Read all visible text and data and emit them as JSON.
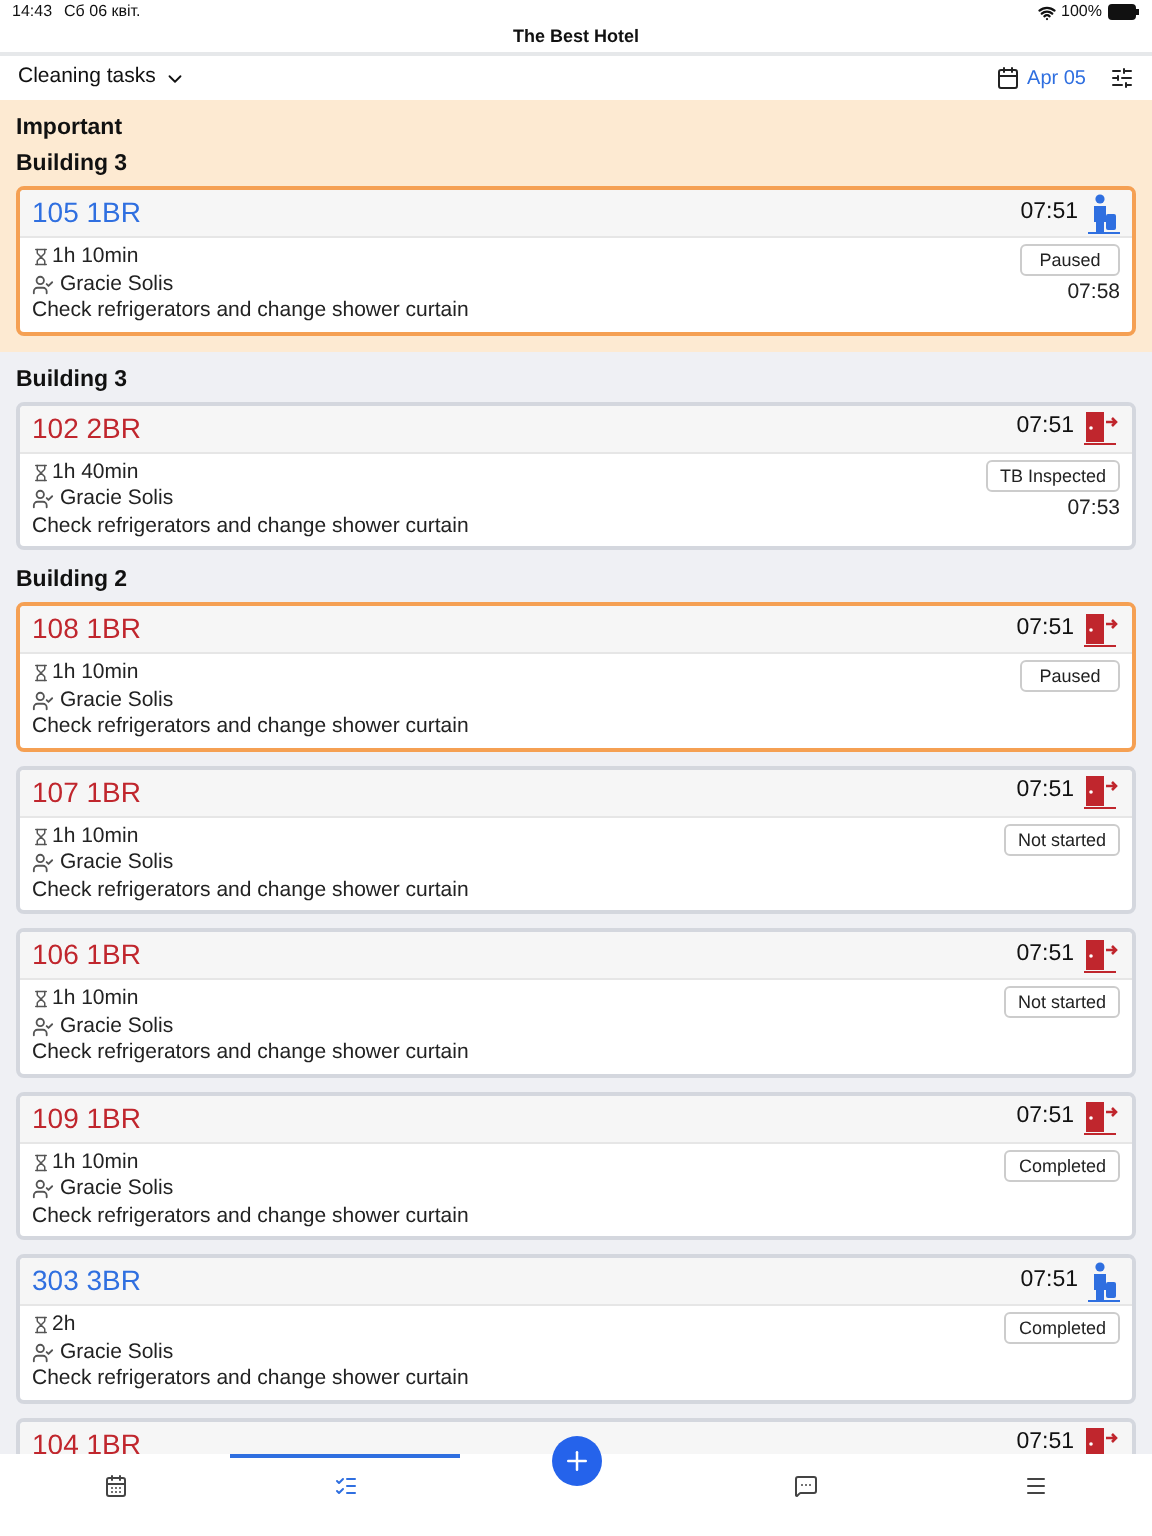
{
  "status_bar": {
    "time": "14:43",
    "date": "Сб 06 квіт.",
    "battery": "100%"
  },
  "app_title": "The Best Hotel",
  "toolbar": {
    "view": "Cleaning tasks",
    "date": "Apr 05"
  },
  "sections": [
    {
      "kind": "important",
      "title": "Important",
      "groups": [
        {
          "building": "Building 3",
          "tasks": [
            {
              "room": "105 1BR",
              "kind": "arrival",
              "time": "07:51",
              "duration": "1h 10min",
              "assignee": "Gracie Solis",
              "note": "Check refrigerators and change shower curtain",
              "status": "Paused",
              "status_time": "07:58",
              "highlighted": true
            }
          ]
        }
      ]
    },
    {
      "kind": "normal",
      "groups": [
        {
          "building": "Building 3",
          "tasks": [
            {
              "room": "102 2BR",
              "kind": "departure",
              "time": "07:51",
              "duration": "1h 40min",
              "assignee": "Gracie Solis",
              "note": "Check refrigerators and change shower curtain",
              "status": "TB Inspected",
              "status_time": "07:53",
              "highlighted": false
            }
          ]
        },
        {
          "building": "Building 2",
          "tasks": [
            {
              "room": "108 1BR",
              "kind": "departure",
              "time": "07:51",
              "duration": "1h 10min",
              "assignee": "Gracie Solis",
              "note": "Check refrigerators and change shower curtain",
              "status": "Paused",
              "highlighted": true
            },
            {
              "room": "107 1BR",
              "kind": "departure",
              "time": "07:51",
              "duration": "1h 10min",
              "assignee": "Gracie Solis",
              "note": "Check refrigerators and change shower curtain",
              "status": "Not started",
              "highlighted": false
            },
            {
              "room": "106 1BR",
              "kind": "departure",
              "time": "07:51",
              "duration": "1h 10min",
              "assignee": "Gracie Solis",
              "note": "Check refrigerators and change shower curtain",
              "status": "Not started",
              "highlighted": false
            },
            {
              "room": "109 1BR",
              "kind": "departure",
              "time": "07:51",
              "duration": "1h 10min",
              "assignee": "Gracie Solis",
              "note": "Check refrigerators and change shower curtain",
              "status": "Completed",
              "highlighted": false
            },
            {
              "room": "303 3BR",
              "kind": "arrival",
              "time": "07:51",
              "duration": "2h",
              "assignee": "Gracie Solis",
              "note": "Check refrigerators and change shower curtain",
              "status": "Completed",
              "highlighted": false
            },
            {
              "room": "104 1BR",
              "kind": "departure",
              "time": "07:51",
              "highlighted": false
            }
          ]
        }
      ]
    }
  ],
  "nav": [
    {
      "kind": "calendar",
      "selected": false
    },
    {
      "kind": "list",
      "selected": true
    },
    {
      "kind": "add",
      "selected": false
    },
    {
      "kind": "chat",
      "selected": false
    },
    {
      "kind": "menu",
      "selected": false
    }
  ]
}
